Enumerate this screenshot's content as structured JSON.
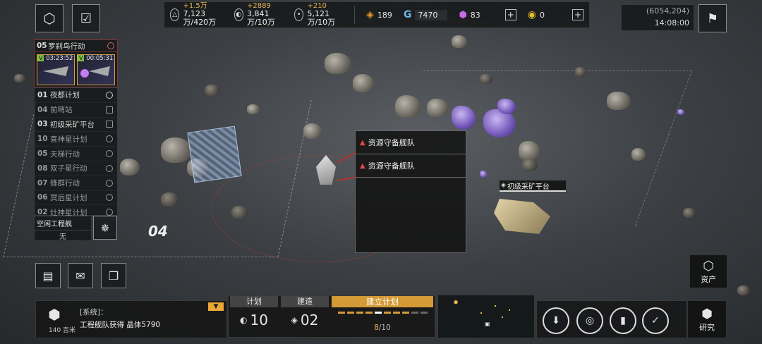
{
  "top_left": {
    "scan_icon": "hexagon-scan-icon",
    "task_icon": "checklist-icon"
  },
  "resources": [
    {
      "icon": "triangle",
      "gain": "+1.5万",
      "total": "7,123万/420万"
    },
    {
      "icon": "ring",
      "gain": "+2889",
      "total": "3,841万/10万"
    },
    {
      "icon": "dot",
      "gain": "+210",
      "total": "5,121万/10万"
    }
  ],
  "currencies": [
    {
      "name": "orange",
      "value": "189"
    },
    {
      "name": "g",
      "value": "7470"
    },
    {
      "name": "p",
      "value": "83"
    },
    {
      "name": "v",
      "value": "0"
    }
  ],
  "coords": "(6054,204)",
  "clock": "14:08:00",
  "current_mission": {
    "num": "05",
    "name": "罗刹鸟行动",
    "timers": [
      "03:23:52",
      "00:05:31"
    ]
  },
  "missions": [
    {
      "num": "01",
      "name": "夜都计划",
      "active": true
    },
    {
      "num": "04",
      "name": "前哨站",
      "active": false
    },
    {
      "num": "03",
      "name": "初级采矿平台",
      "active": true
    },
    {
      "num": "10",
      "name": "喜神星计划",
      "active": false
    },
    {
      "num": "05",
      "name": "天梯行动",
      "active": false
    },
    {
      "num": "08",
      "name": "双子星行动",
      "active": false
    },
    {
      "num": "07",
      "name": "蜂群行动",
      "active": false
    },
    {
      "num": "06",
      "name": "冥后星计划",
      "active": false
    },
    {
      "num": "02",
      "name": "灶神星计划",
      "active": false
    }
  ],
  "idle_ship": {
    "label": "空闲工程舰",
    "value": "无"
  },
  "zone_label": "04",
  "fleet_popup": [
    "资源守备舰队",
    "资源守备舰队"
  ],
  "platform_label": "初级采矿平台",
  "assets_label": "资产",
  "research_label": "研究",
  "system_msg": {
    "prefix": "[系统]：",
    "text": "工程舰队获得 晶体5790",
    "distance": "140 吉米"
  },
  "plan": {
    "plan_label": "计划",
    "plan_value": "10",
    "build_label": "建造",
    "build_value": "02",
    "establish_label": "建立计划",
    "progress": "8",
    "progress_total": "/10"
  }
}
